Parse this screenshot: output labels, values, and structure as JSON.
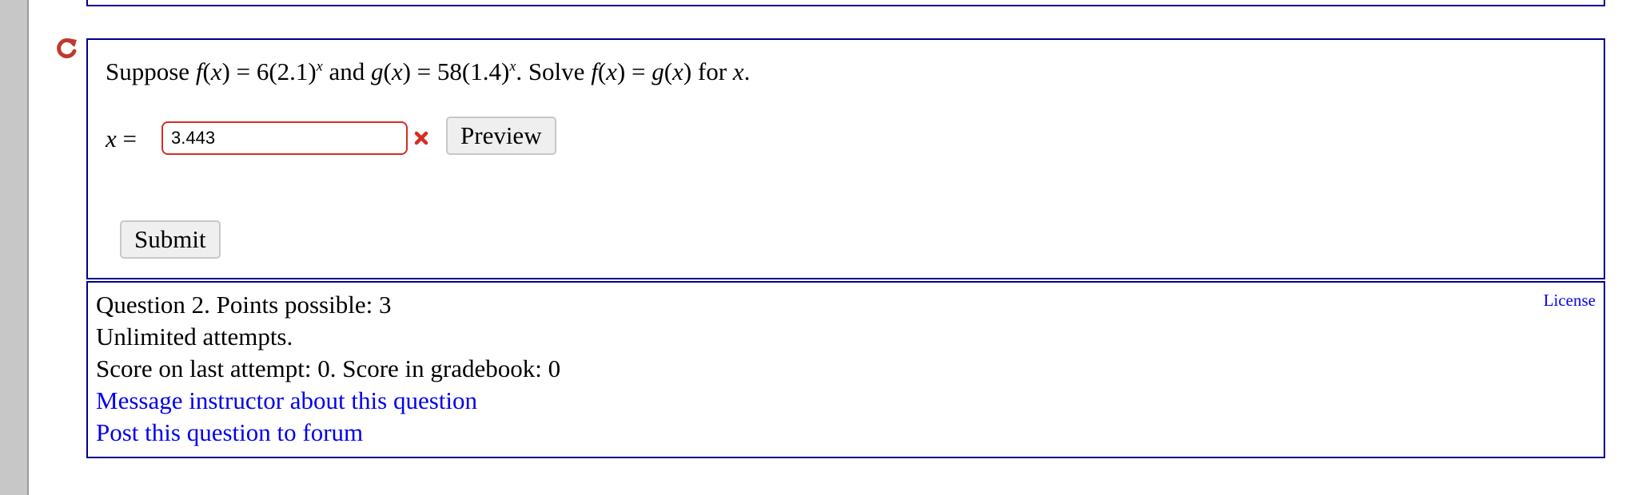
{
  "question": {
    "text_parts": {
      "p1": "Suppose ",
      "f": "f",
      "p2": "(",
      "x1": "x",
      "p3": ") = 6(2.1)",
      "exp1": "x",
      "p4": " and ",
      "g": "g",
      "p5": "(",
      "x2": "x",
      "p6": ") = 58(1.4)",
      "exp2": "x",
      "p7": ". Solve ",
      "f2": "f",
      "p8": "(",
      "x3": "x",
      "p9": ") = ",
      "g2": "g",
      "p10": "(",
      "x4": "x",
      "p11": ") for ",
      "x5": "x",
      "p12": "."
    },
    "answer_label_var": "x",
    "answer_label_eq": " =",
    "answer_value": "3.443",
    "answer_status": "incorrect",
    "preview_label": "Preview",
    "submit_label": "Submit"
  },
  "info": {
    "line1": "Question 2. Points possible: 3",
    "line2": "Unlimited attempts.",
    "line3": "Score on last attempt: 0. Score in gradebook: 0",
    "message_link": "Message instructor about this question",
    "forum_link": "Post this question to forum",
    "license_link": "License"
  },
  "colors": {
    "box_border": "#00008b",
    "link": "#0000ee",
    "error": "#d62d20",
    "retry_icon": "#c0392b"
  },
  "icons": {
    "retry": "retry-icon",
    "incorrect": "incorrect-x-icon"
  }
}
